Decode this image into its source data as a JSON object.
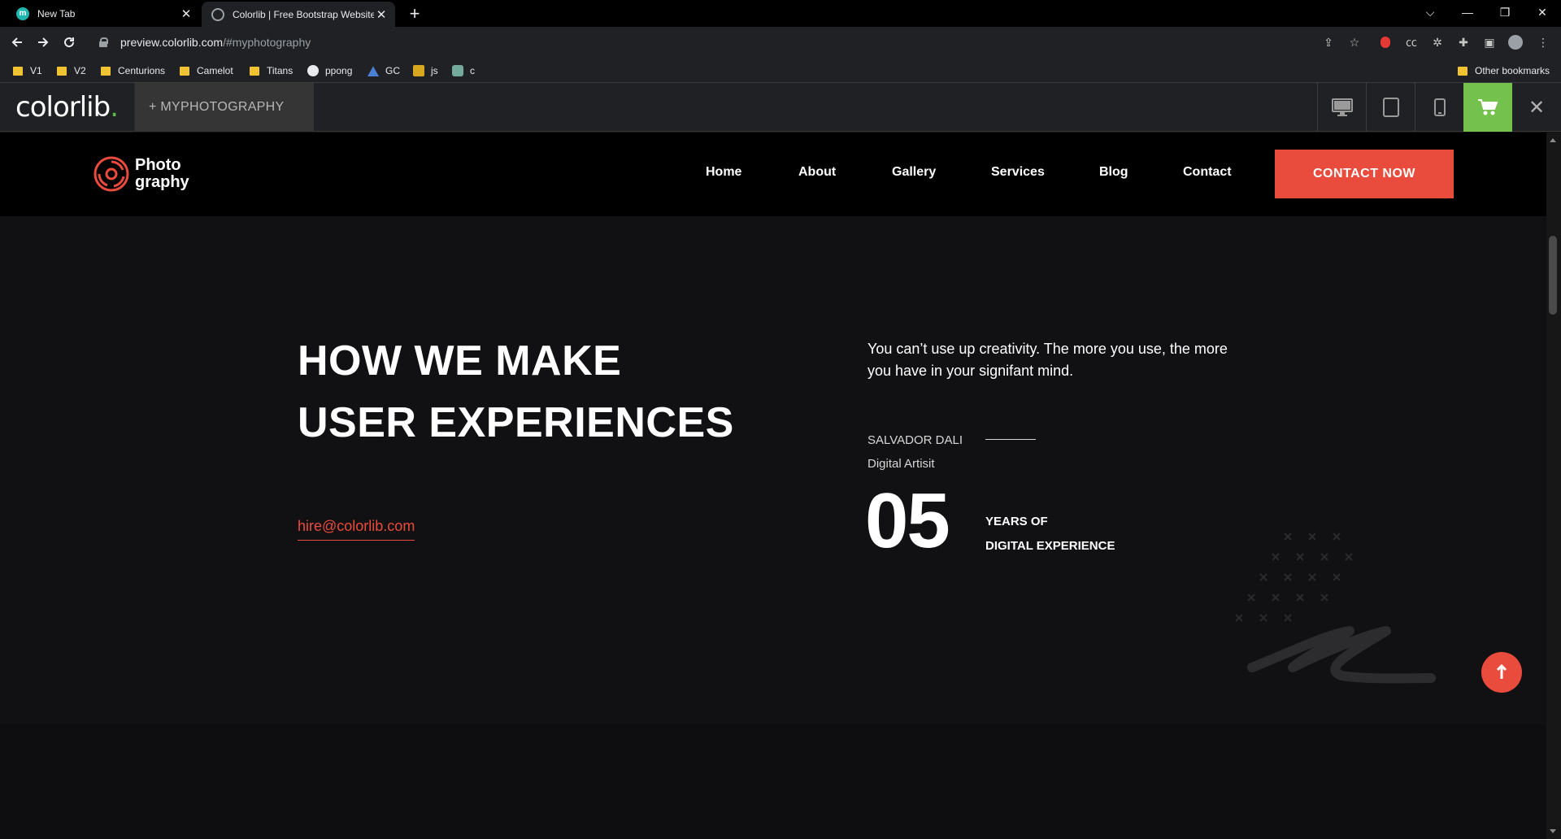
{
  "browser": {
    "tabs": [
      {
        "title": "New Tab",
        "icon": "m-icon"
      },
      {
        "title": "Colorlib | Free Bootstrap Website",
        "icon": "globe-icon"
      }
    ],
    "url_host": "preview.colorlib.com",
    "url_path": "/#myphotography",
    "bookmarks": [
      {
        "label": "V1",
        "icon": "folder-icon"
      },
      {
        "label": "V2",
        "icon": "folder-icon"
      },
      {
        "label": "Centurions",
        "icon": "folder-icon"
      },
      {
        "label": "Camelot",
        "icon": "folder-icon"
      },
      {
        "label": "Titans",
        "icon": "folder-icon"
      },
      {
        "label": "ppong",
        "icon": "globe-icon"
      },
      {
        "label": "GC",
        "icon": "mountain-icon"
      },
      {
        "label": "js",
        "icon": "crown-icon"
      },
      {
        "label": "c",
        "icon": "chat-icon"
      }
    ],
    "other_bookmarks": "Other bookmarks"
  },
  "preview_bar": {
    "logo": "colorlib",
    "logo_dot": ".",
    "theme_name": "+ MYPHOTOGRAPHY",
    "accent": "#75c14e"
  },
  "site": {
    "logo_line1": "Photo",
    "logo_line2": "graphy",
    "nav": [
      "Home",
      "About",
      "Gallery",
      "Services",
      "Blog",
      "Contact"
    ],
    "cta": "CONTACT NOW",
    "accent": "#e94b3c"
  },
  "hero": {
    "headline_line1": "HOW WE MAKE",
    "headline_line2": "USER EXPERIENCES",
    "email": "hire@colorlib.com",
    "quote": "You can’t use up creativity. The more you use, the more you have in your signifant mind.",
    "author": "SALVADOR DALI",
    "role": "Digital Artisit",
    "years": "05",
    "years_label1": "YEARS OF",
    "years_label2": "DIGITAL EXPERIENCE"
  }
}
